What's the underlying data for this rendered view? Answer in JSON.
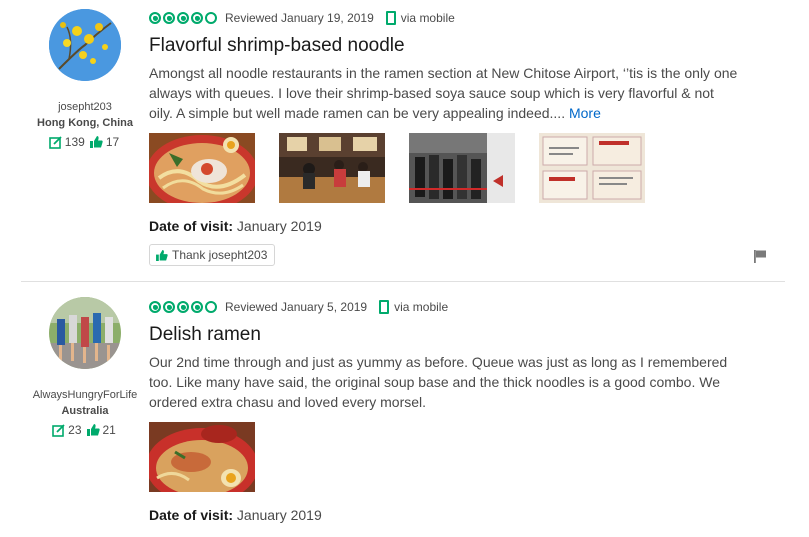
{
  "reviews": [
    {
      "username": "josepht203",
      "location": "Hong Kong, China",
      "contributions": "139",
      "helpful_votes": "17",
      "rating": 4,
      "reviewed": "Reviewed January 19, 2019",
      "via": "via mobile",
      "title": "Flavorful shrimp-based noodle",
      "text": "Amongst all noodle restaurants in the ramen section at New Chitose Airport, ‘’tis is the only one always with queues. I love their shrimp-based soya sauce soup which is very flavorful & not oily. A simple but well made ramen can be very appealing indeed....",
      "more": "More",
      "date_label": "Date of visit:",
      "date_value": "January 2019",
      "thank_label": "Thank josepht203"
    },
    {
      "username": "AlwaysHungryForLife",
      "location": "Australia",
      "contributions": "23",
      "helpful_votes": "21",
      "rating": 4,
      "reviewed": "Reviewed January 5, 2019",
      "via": "via mobile",
      "title": "Delish ramen",
      "text": "Our 2nd time through and just as yummy as before. Queue was just as long as I remembered too. Like many have said, the original soup base and the thick noodles is a good combo. We ordered extra chasu and loved every morsel.",
      "date_label": "Date of visit:",
      "date_value": "January 2019"
    }
  ],
  "colors": {
    "accent": "#00aa6c",
    "link": "#0068c9"
  }
}
